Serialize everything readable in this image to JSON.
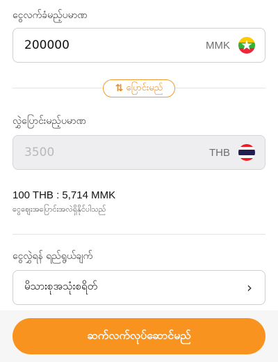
{
  "send": {
    "label": "ငွေလက်ခံမည့်ပမာဏ",
    "value": "200000",
    "currency": "MMK",
    "flag_icon": "myanmar-flag-icon"
  },
  "swap": {
    "label": "ပြောင်းမည်",
    "icon": "swap-arrows-icon",
    "accent": "#f7931e"
  },
  "receive": {
    "label": "လွှဲပြောင်းမည့်ပမာဏ",
    "placeholder": "3500",
    "currency": "THB",
    "flag_icon": "thailand-flag-icon"
  },
  "rate": {
    "text": "100 THB : 5,714 MMK",
    "note": "ငွေဈေးအပြောင်းအလဲရှိနိုင်ပါသည်"
  },
  "purpose": {
    "label": "ငွေလွှဲရန် ရည်ရွယ်ချက်",
    "selected": "မိသားစုအသုံးစရိတ်",
    "icon": "chevron-right-icon"
  },
  "footer": {
    "continue_label": "ဆက်လက်လုပ်ဆောင်မည်"
  }
}
